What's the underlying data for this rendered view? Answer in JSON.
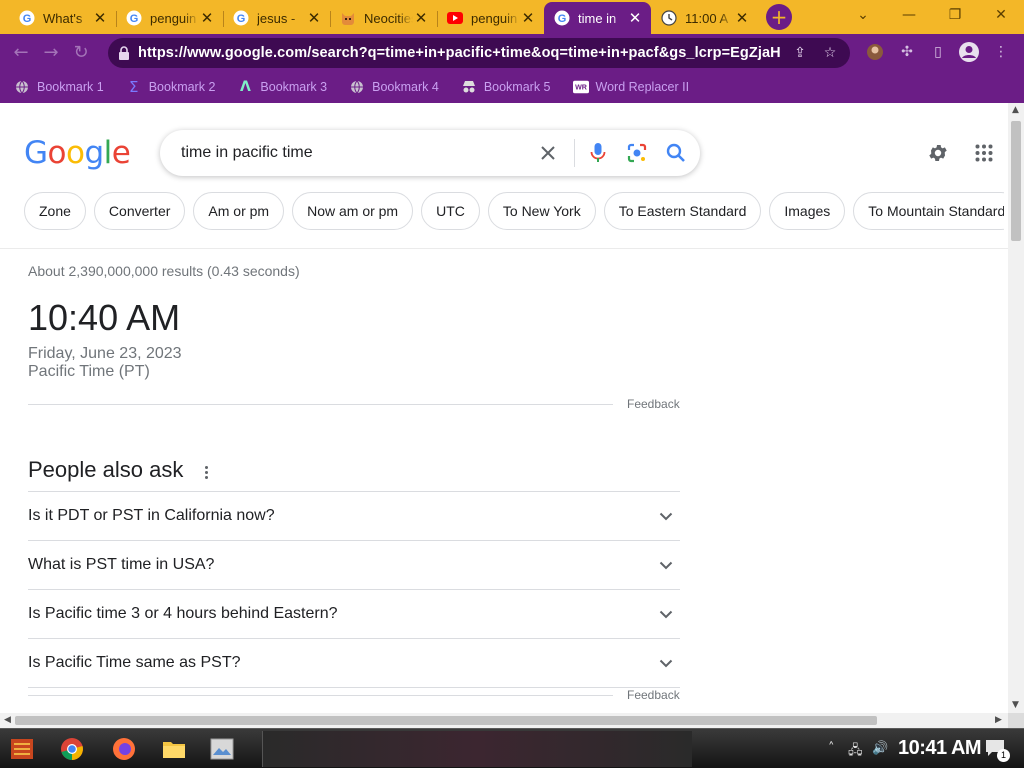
{
  "browser": {
    "tabs": [
      {
        "title": "What's",
        "icon": "google-icon"
      },
      {
        "title": "penguin",
        "icon": "google-icon"
      },
      {
        "title": "jesus -",
        "icon": "google-icon"
      },
      {
        "title": "Neocities",
        "icon": "neocities-cat-icon"
      },
      {
        "title": "penguin",
        "icon": "youtube-icon"
      },
      {
        "title": "time in",
        "icon": "google-icon",
        "active": true
      },
      {
        "title": "11:00 A",
        "icon": "clock-icon"
      }
    ],
    "new_tab_label": "+",
    "url": "https://www.google.com/search?q=time+in+pacific+time&oq=time+in+pacf&gs_lcrp=EgZjaHJvbW...",
    "bookmarks": [
      {
        "label": "Bookmark 1",
        "icon": "globe-icon"
      },
      {
        "label": "Bookmark 2",
        "icon": "sigma-icon"
      },
      {
        "label": "Bookmark 3",
        "icon": "lambda-icon"
      },
      {
        "label": "Bookmark 4",
        "icon": "globe-icon"
      },
      {
        "label": "Bookmark 5",
        "icon": "spy-icon"
      },
      {
        "label": "Word Replacer II",
        "icon": "wr-icon"
      }
    ],
    "colors": {
      "tab_strip": "#f3b728",
      "toolbar": "#6b1d86",
      "bookmark_text": "#c9a0f0"
    }
  },
  "google": {
    "logo": "Google",
    "query": "time in pacific time",
    "chips": [
      "Zone",
      "Converter",
      "Am or pm",
      "Now am or pm",
      "UTC",
      "To New York",
      "To Eastern Standard",
      "Images",
      "To Mountain Standard"
    ],
    "result_stats": "About 2,390,000,000 results (0.43 seconds)",
    "time": "10:40 AM",
    "date": "Friday, June 23, 2023",
    "zone": "Pacific Time (PT)",
    "feedback_label": "Feedback",
    "people_also_ask": {
      "title": "People also ask",
      "questions": [
        "Is it PDT or PST in California now?",
        "What is PST time in USA?",
        "Is Pacific time 3 or 4 hours behind Eastern?",
        "Is Pacific Time same as PST?"
      ]
    }
  },
  "taskbar": {
    "clock": "10:41 AM",
    "apps": [
      "start-icon",
      "chrome-icon",
      "firefox-icon",
      "file-explorer-icon",
      "image-viewer-icon"
    ],
    "notification_count": "1"
  }
}
